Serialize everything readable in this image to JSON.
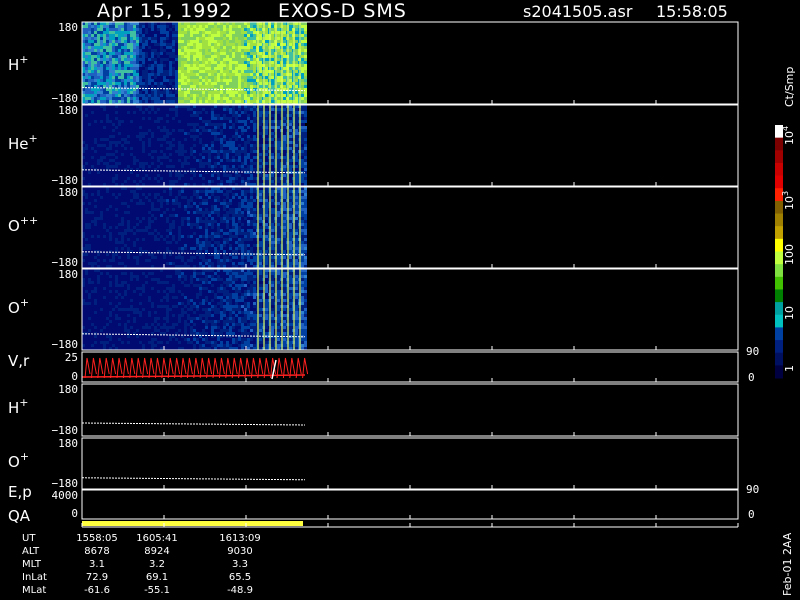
{
  "header": {
    "date": "Apr 15, 1992",
    "instrument": "EXOS-D SMS",
    "file": "s2041505.asr",
    "time": "15:58:05"
  },
  "colorbar": {
    "label": "Ct/Smp",
    "ticks": [
      "10",
      "10",
      "100",
      "10",
      "1"
    ],
    "tick_exponents": [
      "4",
      "3",
      "",
      "",
      ""
    ],
    "colors": [
      "#ffffff",
      "#7a0000",
      "#a00000",
      "#c80000",
      "#e00000",
      "#ff2000",
      "#806000",
      "#a08000",
      "#c0a000",
      "#ffff00",
      "#c0ff40",
      "#80e040",
      "#40c000",
      "#008000",
      "#00a0a0",
      "#00c0c0",
      "#0040a0",
      "#002080",
      "#001060",
      "#000040"
    ]
  },
  "chart_data": {
    "type": "heatmap",
    "x_ticks": [
      "1558:05",
      "1605:41",
      "1613:09"
    ],
    "panels": [
      {
        "name": "H",
        "sup": "+",
        "ylim": [
          "180",
          "-180"
        ]
      },
      {
        "name": "He",
        "sup": "+",
        "ylim": [
          "180",
          "-180"
        ]
      },
      {
        "name": "O",
        "sup": "++",
        "ylim": [
          "180",
          "-180"
        ]
      },
      {
        "name": "O",
        "sup": "+",
        "ylim": [
          "180",
          "-180"
        ]
      },
      {
        "name": "V,r",
        "sup": "",
        "ylim": [
          "25",
          "0"
        ],
        "right_ticks": [
          "90",
          "0"
        ]
      },
      {
        "name": "H",
        "sup": "+",
        "ylim": [
          "180",
          "-180"
        ]
      },
      {
        "name": "O",
        "sup": "+",
        "ylim": [
          "180",
          "-180"
        ]
      },
      {
        "name": "E,p",
        "sup": "",
        "ylim": [
          "4000",
          "0"
        ],
        "right_ticks": [
          "90",
          "0"
        ]
      },
      {
        "name": "QA",
        "sup": "",
        "ylim": [
          "",
          ""
        ]
      }
    ],
    "orbit": {
      "rows": [
        {
          "label": "UT",
          "values": [
            "1558:05",
            "1605:41",
            "1613:09"
          ]
        },
        {
          "label": "ALT",
          "values": [
            "8678",
            "8924",
            "9030"
          ]
        },
        {
          "label": "MLT",
          "values": [
            "3.1",
            "3.2",
            "3.3"
          ]
        },
        {
          "label": "InLat",
          "values": [
            "72.9",
            "69.1",
            "65.5"
          ]
        },
        {
          "label": "MLat",
          "values": [
            "-61.6",
            "-55.1",
            "-48.9"
          ]
        }
      ]
    }
  },
  "footer": {
    "stamp": "Feb-01 2AA"
  }
}
